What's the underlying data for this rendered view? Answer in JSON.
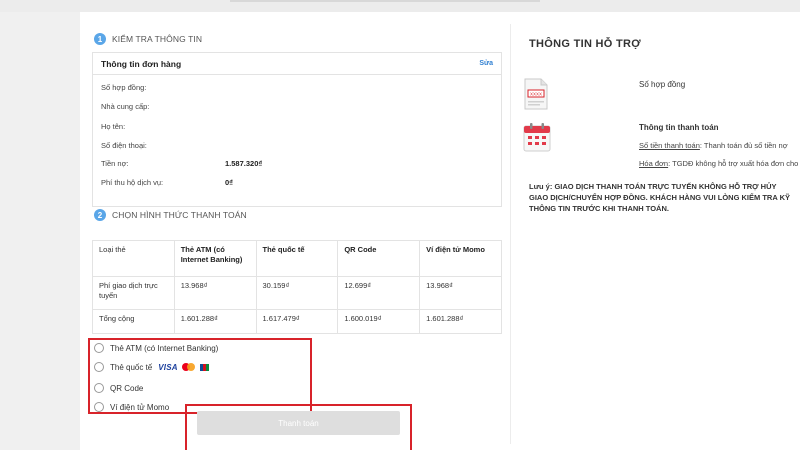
{
  "step1": {
    "number": "1",
    "title": "KIỂM TRA THÔNG TIN"
  },
  "order": {
    "title": "Thông tin đơn hàng",
    "edit_label": "Sửa",
    "rows": [
      {
        "label": "Số hợp đồng:",
        "value": ""
      },
      {
        "label": "Nhà cung cấp:",
        "value": ""
      },
      {
        "label": "Họ tên:",
        "value": ""
      },
      {
        "label": "Số điện thoại:",
        "value": ""
      },
      {
        "label": "Tiền nợ:",
        "value": "1.587.320₫"
      },
      {
        "label": "Phí thu hộ dịch vụ:",
        "value": "0₫"
      }
    ]
  },
  "step2": {
    "number": "2",
    "title": "CHỌN HÌNH THỨC THANH TOÁN"
  },
  "payment_table": {
    "headers": [
      "Loại thẻ",
      "Thẻ ATM (có Internet Banking)",
      "Thẻ quốc tế",
      "QR Code",
      "Ví điện tử Momo"
    ],
    "rows": [
      [
        "Phí giao dịch trực tuyến",
        "13.968₫",
        "30.159₫",
        "12.699₫",
        "13.968₫"
      ],
      [
        "Tổng cộng",
        "1.601.288₫",
        "1.617.479₫",
        "1.600.019₫",
        "1.601.288₫"
      ]
    ]
  },
  "options": [
    {
      "label": "Thẻ ATM (có Internet Banking)",
      "selected": false
    },
    {
      "label": "Thẻ quốc tế",
      "selected": false,
      "brand_visa": "VISA"
    },
    {
      "label": "QR Code",
      "selected": false
    },
    {
      "label": "Ví điện tử Momo",
      "selected": false
    }
  ],
  "pay_button": {
    "label": "Thanh toán",
    "enabled": false
  },
  "support": {
    "title": "THÔNG TIN HỖ TRỢ",
    "contract": {
      "label": "Số hợp đồng",
      "icon_text": "XXXX"
    },
    "payment_info": {
      "label": "Thông tin thanh toán",
      "line1_label": "Số tiền thanh toán",
      "line1_text": ": Thanh toán đủ số tiền nợ",
      "line2_label": "Hóa đơn",
      "line2_text": ": TGDĐ không hỗ trợ xuất hóa đơn cho dịch vụ này."
    },
    "note_label": "Lưu ý",
    "note_text": ": GIAO DỊCH THANH TOÁN TRỰC TUYẾN KHÔNG HỖ TRỢ HỦY GIAO DỊCH/CHUYỂN HỢP ĐỒNG. KHÁCH HÀNG VUI LÒNG KIỂM TRA KỸ THÔNG TIN TRƯỚC KHI THANH TOÁN."
  },
  "colors": {
    "accent_blue": "#5aa6e8",
    "highlight_red": "#d8232a",
    "link_blue": "#2f7fd1",
    "disabled_button": "#dedede"
  }
}
